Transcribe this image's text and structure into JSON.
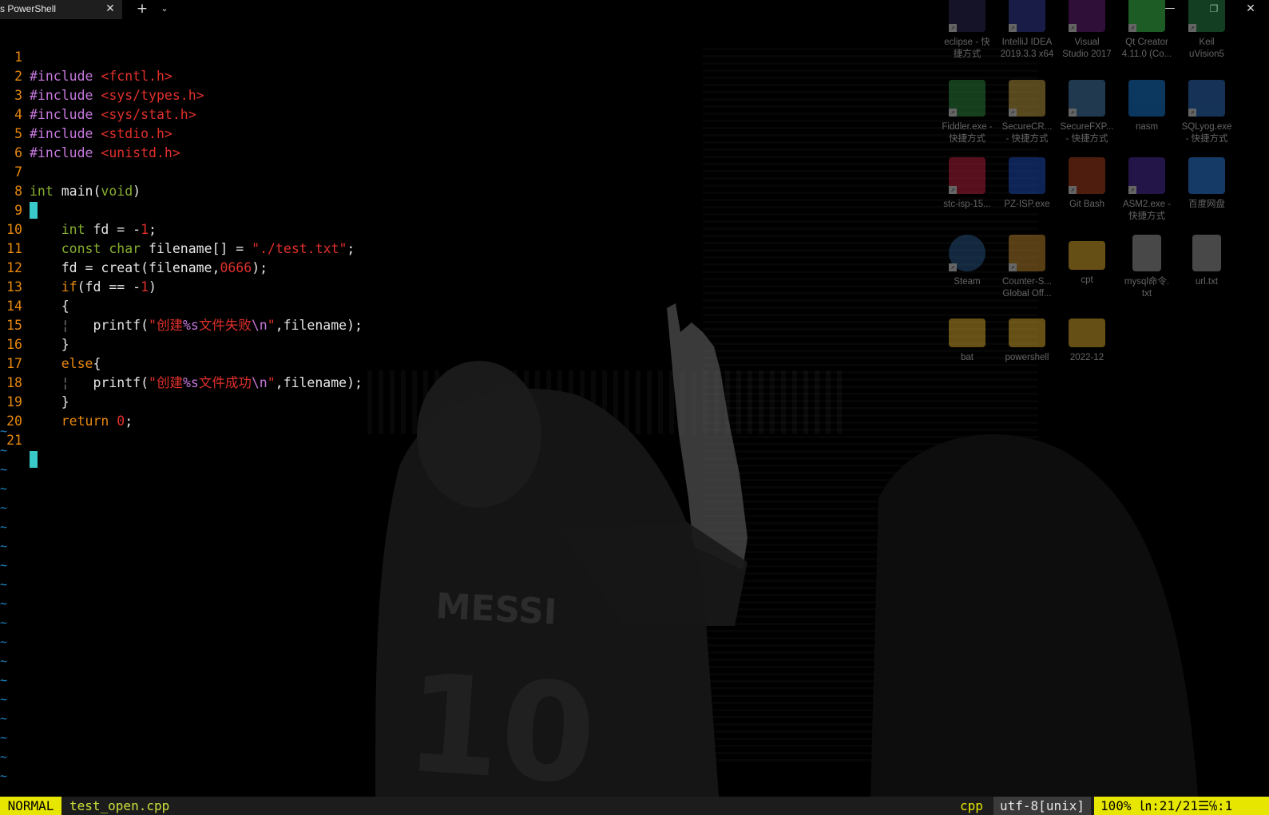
{
  "window": {
    "tab_title": "s PowerShell",
    "close_tab": "✕",
    "new_tab": "+",
    "dropdown": "⌄",
    "minimize": "—",
    "maximize": "❐",
    "close": "✕"
  },
  "desktop_icons": [
    {
      "label1": "eclipse - 快",
      "label2": "捷方式",
      "color": "#2d2a5a"
    },
    {
      "label1": "IntelliJ IDEA",
      "label2": "2019.3.3 x64",
      "color": "#3a3fa0"
    },
    {
      "label1": "Visual",
      "label2": "Studio 2017",
      "color": "#68217a"
    },
    {
      "label1": "Qt Creator",
      "label2": "4.11.0 (Co...",
      "color": "#41cd52"
    },
    {
      "label1": "Keil",
      "label2": "uVision5",
      "color": "#2d8a4a"
    },
    {
      "label1": "Fiddler.exe -",
      "label2": "快捷方式",
      "color": "#2e8b3e"
    },
    {
      "label1": "SecureCR...",
      "label2": "- 快捷方式",
      "color": "#c0a040"
    },
    {
      "label1": "SecureFXP...",
      "label2": "- 快捷方式",
      "color": "#4a7fb0"
    },
    {
      "label1": "nasm",
      "label2": "",
      "color": "#1a7bd0"
    },
    {
      "label1": "SQLyog.exe",
      "label2": "- 快捷方式",
      "color": "#3070c0"
    },
    {
      "label1": "stc-isp-15...",
      "label2": "",
      "color": "#c02040"
    },
    {
      "label1": "PZ-ISP.exe",
      "label2": "",
      "color": "#2050c0"
    },
    {
      "label1": "Git Bash",
      "label2": "",
      "color": "#b04020"
    },
    {
      "label1": "ASM2.exe -",
      "label2": "快捷方式",
      "color": "#5030a0"
    },
    {
      "label1": "百度网盘",
      "label2": "",
      "color": "#3080e0"
    },
    {
      "label1": "Steam",
      "label2": "",
      "color": "#2a5a8a"
    },
    {
      "label1": "Counter-S...",
      "label2": "Global Off...",
      "color": "#c08a30"
    },
    {
      "label1": "cpt",
      "label2": "",
      "color": "#e0b030"
    },
    {
      "label1": "mysql命令.",
      "label2": "txt",
      "color": "#a0a0a0"
    },
    {
      "label1": "url.txt",
      "label2": "",
      "color": "#a0a0a0"
    },
    {
      "label1": "bat",
      "label2": "",
      "color": "#e0b030"
    },
    {
      "label1": "powershell",
      "label2": "",
      "color": "#e0b030"
    },
    {
      "label1": "2022-12",
      "label2": "",
      "color": "#e0b030"
    }
  ],
  "wallpaper": {
    "jersey_name": "MESSI",
    "jersey_number": "10"
  },
  "editor": {
    "line_numbers": [
      "1",
      "2",
      "3",
      "4",
      "5",
      "6",
      "7",
      "8",
      "9",
      "10",
      "11",
      "12",
      "13",
      "14",
      "15",
      "16",
      "17",
      "18",
      "19",
      "20",
      "21"
    ],
    "inc": "#include",
    "headers": [
      "<fcntl.h>",
      "<sys/types.h>",
      "<sys/stat.h>",
      "<stdio.h>",
      "<unistd.h>"
    ],
    "int_kw": "int",
    "main_sig": " main(",
    "void_kw": "void",
    "rparen": ")",
    "decl_fd": " fd = -",
    "num_one": "1",
    "semi": ";",
    "const_kw": "const",
    "char_kw": " char",
    "filename_decl": " filename[] = ",
    "path_str": "\"./test.txt\"",
    "creat_pre": "fd = creat(filename,",
    "mode_num": "0666",
    "creat_post": ");",
    "if_kw": "if",
    "if_cond": "(fd == -",
    "lbrace": "{",
    "rbrace": "}",
    "guide": "¦",
    "printf_pre": "printf(",
    "fail_str_a": "\"创建",
    "fmt_s": "%s",
    "fail_str_b": "文件失败",
    "esc_n": "\\n",
    "quote": "\"",
    "printf_post": ",filename);",
    "ok_str_b": "文件成功",
    "else_kw": "else",
    "return_kw": "return",
    "zero": " 0",
    "tilde": "~"
  },
  "statusline": {
    "mode": "NORMAL",
    "filename": "test_open.cpp",
    "filetype": "cpp",
    "encoding": "utf-8[unix]",
    "position": "100%  ㏑:21/21☰℅:1"
  }
}
